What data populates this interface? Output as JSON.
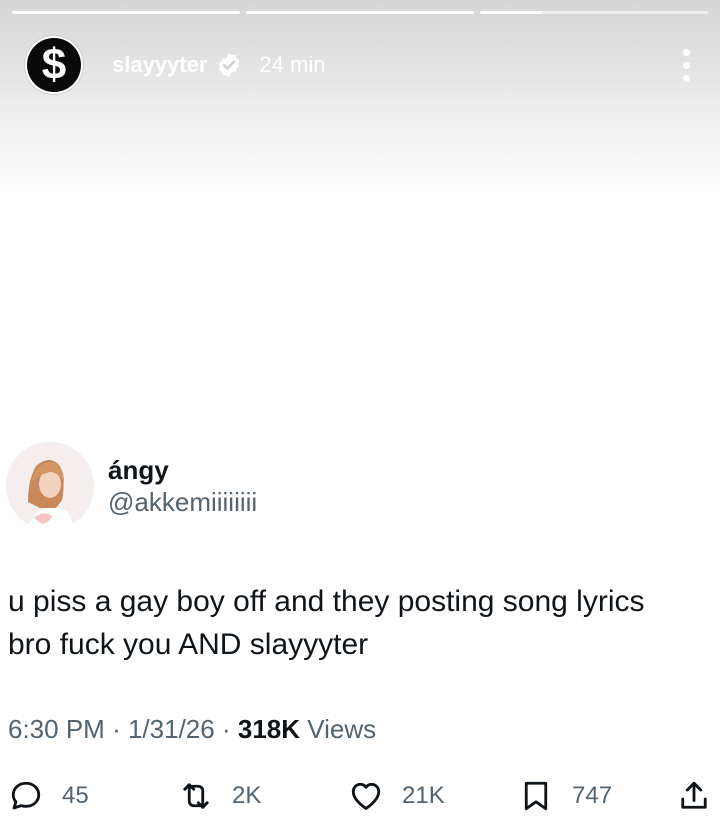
{
  "story": {
    "progress": [
      1.0,
      1.0,
      0.27
    ],
    "username": "slayyyter",
    "time": "24 min",
    "avatar_glyph": "$",
    "icons": {
      "verified": "verified-badge-icon",
      "more": "more-vertical-icon"
    }
  },
  "tweet": {
    "name": "ángy",
    "handle": "@akkemiiiiiiii",
    "text_line1": "u piss a gay boy off and they posting song lyrics",
    "text_line2": "bro fuck you AND slayyyter",
    "time": "6:30 PM",
    "separator": "·",
    "date": "1/31/26",
    "views_count": "318K",
    "views_label": "Views",
    "actions": {
      "replies": "45",
      "reposts": "2K",
      "likes": "21K",
      "bookmarks": "747"
    }
  },
  "colors": {
    "text": "#0f1419",
    "muted": "#536471",
    "header_text": "#ffffff"
  }
}
